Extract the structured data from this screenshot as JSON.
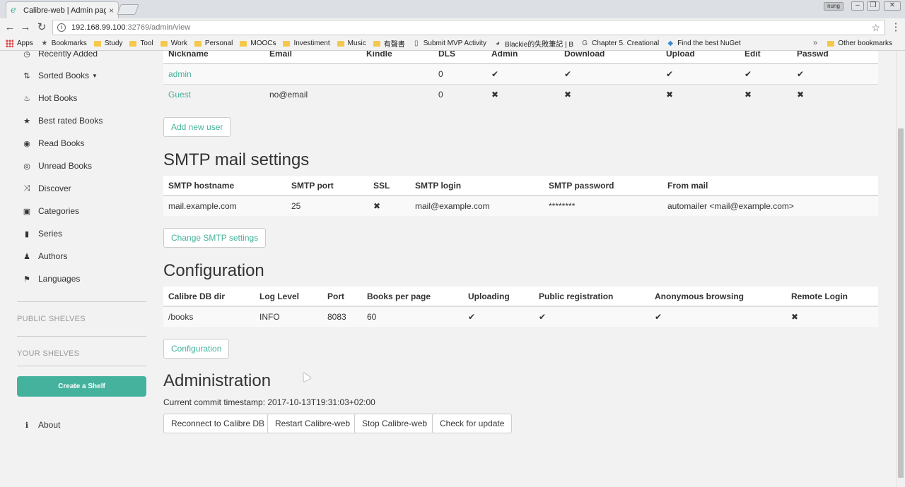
{
  "browser": {
    "tab_title": "Calibre-web | Admin pag",
    "tab_favicon": "e",
    "tab_close": "×",
    "profile": "nung",
    "window_buttons": [
      "‒",
      "❐",
      "✕"
    ],
    "url_host": "192.168.99.100",
    "url_rest": ":32769/admin/view",
    "bookmarks": [
      {
        "label": "Apps",
        "icon": "apps-grid-icon"
      },
      {
        "label": "Bookmarks",
        "icon": "star-icon"
      },
      {
        "label": "Study",
        "icon": "folder-icon"
      },
      {
        "label": "Tool",
        "icon": "folder-icon"
      },
      {
        "label": "Work",
        "icon": "folder-icon"
      },
      {
        "label": "Personal",
        "icon": "folder-icon"
      },
      {
        "label": "MOOCs",
        "icon": "folder-icon"
      },
      {
        "label": "Investiment",
        "icon": "folder-icon"
      },
      {
        "label": "Music",
        "icon": "folder-icon"
      },
      {
        "label": "有聲書",
        "icon": "folder-icon"
      },
      {
        "label": "Submit MVP Activity",
        "icon": "page-icon"
      },
      {
        "label": "Blackie的失敗筆記 | B",
        "icon": "avatar-icon"
      },
      {
        "label": "Chapter 5. Creational",
        "icon": "google-icon"
      },
      {
        "label": "Find the best NuGet",
        "icon": "nuget-icon"
      }
    ],
    "more_bookmarks": "»",
    "other_bookmarks": "Other bookmarks"
  },
  "sidebar": {
    "items": [
      {
        "label": "Recently Added",
        "icon": "clock-icon",
        "glyph": "◷"
      },
      {
        "label": "Sorted Books",
        "icon": "sort-icon",
        "glyph": "⇅"
      },
      {
        "label": "Hot Books",
        "icon": "fire-icon",
        "glyph": "♨"
      },
      {
        "label": "Best rated Books",
        "icon": "star-icon",
        "glyph": "★"
      },
      {
        "label": "Read Books",
        "icon": "eye-icon",
        "glyph": "◉"
      },
      {
        "label": "Unread Books",
        "icon": "eye-slash-icon",
        "glyph": "◎"
      },
      {
        "label": "Discover",
        "icon": "random-icon",
        "glyph": "⤨"
      },
      {
        "label": "Categories",
        "icon": "inbox-icon",
        "glyph": "▣"
      },
      {
        "label": "Series",
        "icon": "bookmark-icon",
        "glyph": "▮"
      },
      {
        "label": "Authors",
        "icon": "user-icon",
        "glyph": "♟"
      },
      {
        "label": "Languages",
        "icon": "flag-icon",
        "glyph": "⚑"
      }
    ],
    "caret": "▼",
    "public_shelves": "PUBLIC SHELVES",
    "your_shelves": "YOUR SHELVES",
    "create_shelf": "Create a Shelf",
    "about": "About",
    "about_glyph": "ℹ"
  },
  "users": {
    "headers": [
      "Nickname",
      "Email",
      "Kindle",
      "DLS",
      "Admin",
      "Download",
      "Upload",
      "Edit",
      "Passwd"
    ],
    "rows": [
      {
        "nickname": "admin",
        "email": "",
        "kindle": "",
        "dls": "0",
        "admin": "✔",
        "download": "✔",
        "upload": "✔",
        "edit": "✔",
        "passwd": "✔"
      },
      {
        "nickname": "Guest",
        "email": "no@email",
        "kindle": "",
        "dls": "0",
        "admin": "✖",
        "download": "✖",
        "upload": "✖",
        "edit": "✖",
        "passwd": "✖"
      }
    ],
    "add_button": "Add new user"
  },
  "smtp": {
    "title": "SMTP mail settings",
    "headers": [
      "SMTP hostname",
      "SMTP port",
      "SSL",
      "SMTP login",
      "SMTP password",
      "From mail"
    ],
    "row": {
      "hostname": "mail.example.com",
      "port": "25",
      "ssl": "✖",
      "login": "mail@example.com",
      "password": "********",
      "from": "automailer <mail@example.com>"
    },
    "change_button": "Change SMTP settings"
  },
  "config": {
    "title": "Configuration",
    "headers": [
      "Calibre DB dir",
      "Log Level",
      "Port",
      "Books per page",
      "Uploading",
      "Public registration",
      "Anonymous browsing",
      "Remote Login"
    ],
    "row": {
      "db_dir": "/books",
      "log_level": "INFO",
      "port": "8083",
      "books_per_page": "60",
      "uploading": "✔",
      "public_registration": "✔",
      "anonymous_browsing": "✔",
      "remote_login": "✖"
    },
    "button": "Configuration"
  },
  "admin": {
    "title": "Administration",
    "commit": "Current commit timestamp: 2017-10-13T19:31:03+02:00",
    "buttons": [
      "Reconnect to Calibre DB",
      "Restart Calibre-web",
      "Stop Calibre-web",
      "Check for update"
    ]
  }
}
